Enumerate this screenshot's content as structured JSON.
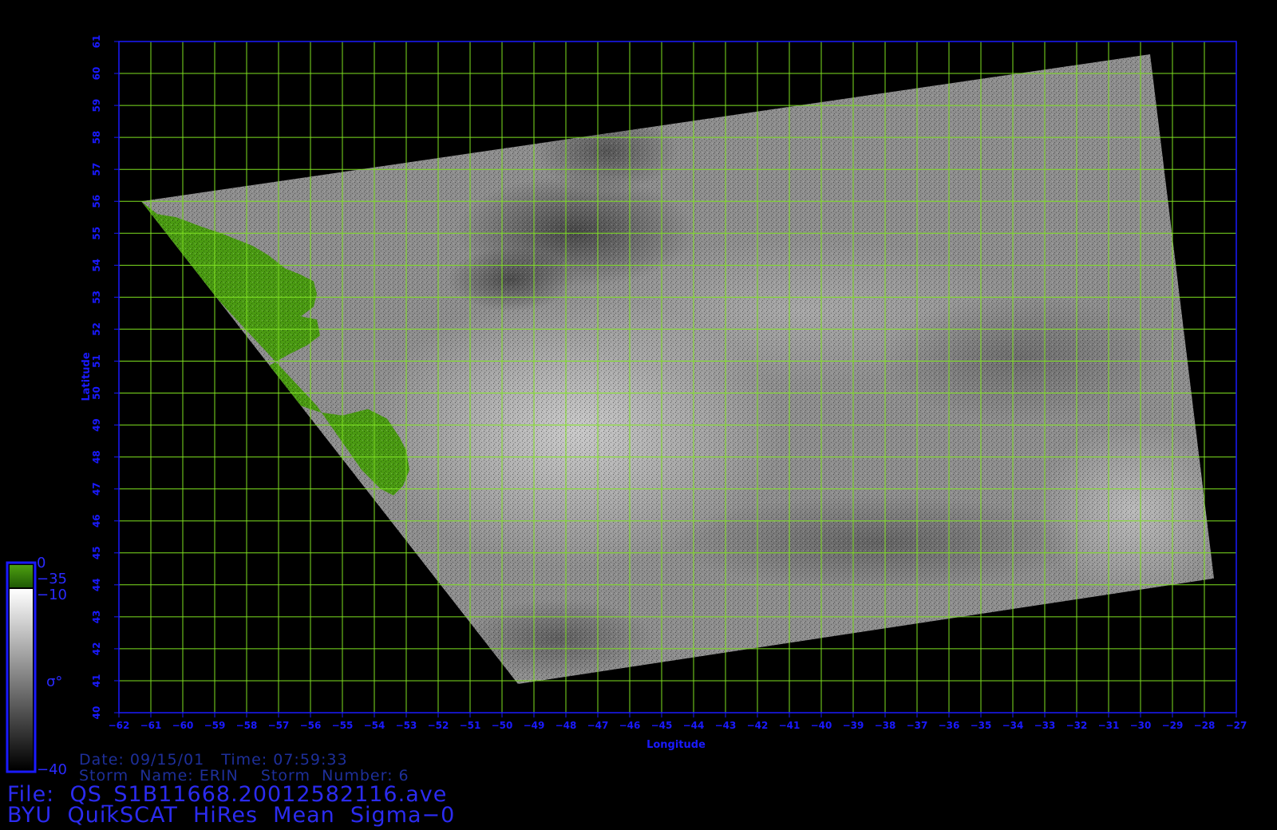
{
  "map": {
    "lon_range": [
      -62,
      -27
    ],
    "lat_range": [
      40,
      61
    ],
    "grid_step_deg": 1,
    "x_ticks": [
      -62,
      -61,
      -60,
      -59,
      -58,
      -57,
      -56,
      -55,
      -54,
      -53,
      -52,
      -51,
      -50,
      -49,
      -48,
      -47,
      -46,
      -45,
      -44,
      -43,
      -42,
      -41,
      -40,
      -39,
      -38,
      -37,
      -36,
      -35,
      -34,
      -33,
      -32,
      -31,
      -30,
      -29,
      -28,
      -27
    ],
    "y_ticks": [
      40,
      41,
      42,
      43,
      44,
      45,
      46,
      47,
      48,
      49,
      50,
      51,
      52,
      53,
      54,
      55,
      56,
      57,
      58,
      59,
      60,
      61
    ],
    "x_axis_label": "Longitude",
    "y_axis_label": "Latitude",
    "grid_color": "#7ee020",
    "axis_color": "#1a1aff",
    "land_color": "#4a9a12",
    "swath_corners_lonlat": [
      [
        -61.3,
        56.0
      ],
      [
        -29.7,
        60.6
      ],
      [
        -27.7,
        44.2
      ],
      [
        -49.5,
        40.9
      ]
    ]
  },
  "colorbar": {
    "land_top_label": "0",
    "land_bottom_label": "−35",
    "scale_top_label": "−10",
    "scale_bottom_label": "−40",
    "symbol": "σ°"
  },
  "info": {
    "date_line": "Date: 09/15/01   Time: 07:59:33",
    "storm_line": "Storm  Name: ERIN    Storm  Number: 6",
    "file_line": "File:  QS_S1B11668.20012582116.ave",
    "title_line": "BYU  QuikSCAT  HiRes  Mean  Sigma−0"
  }
}
